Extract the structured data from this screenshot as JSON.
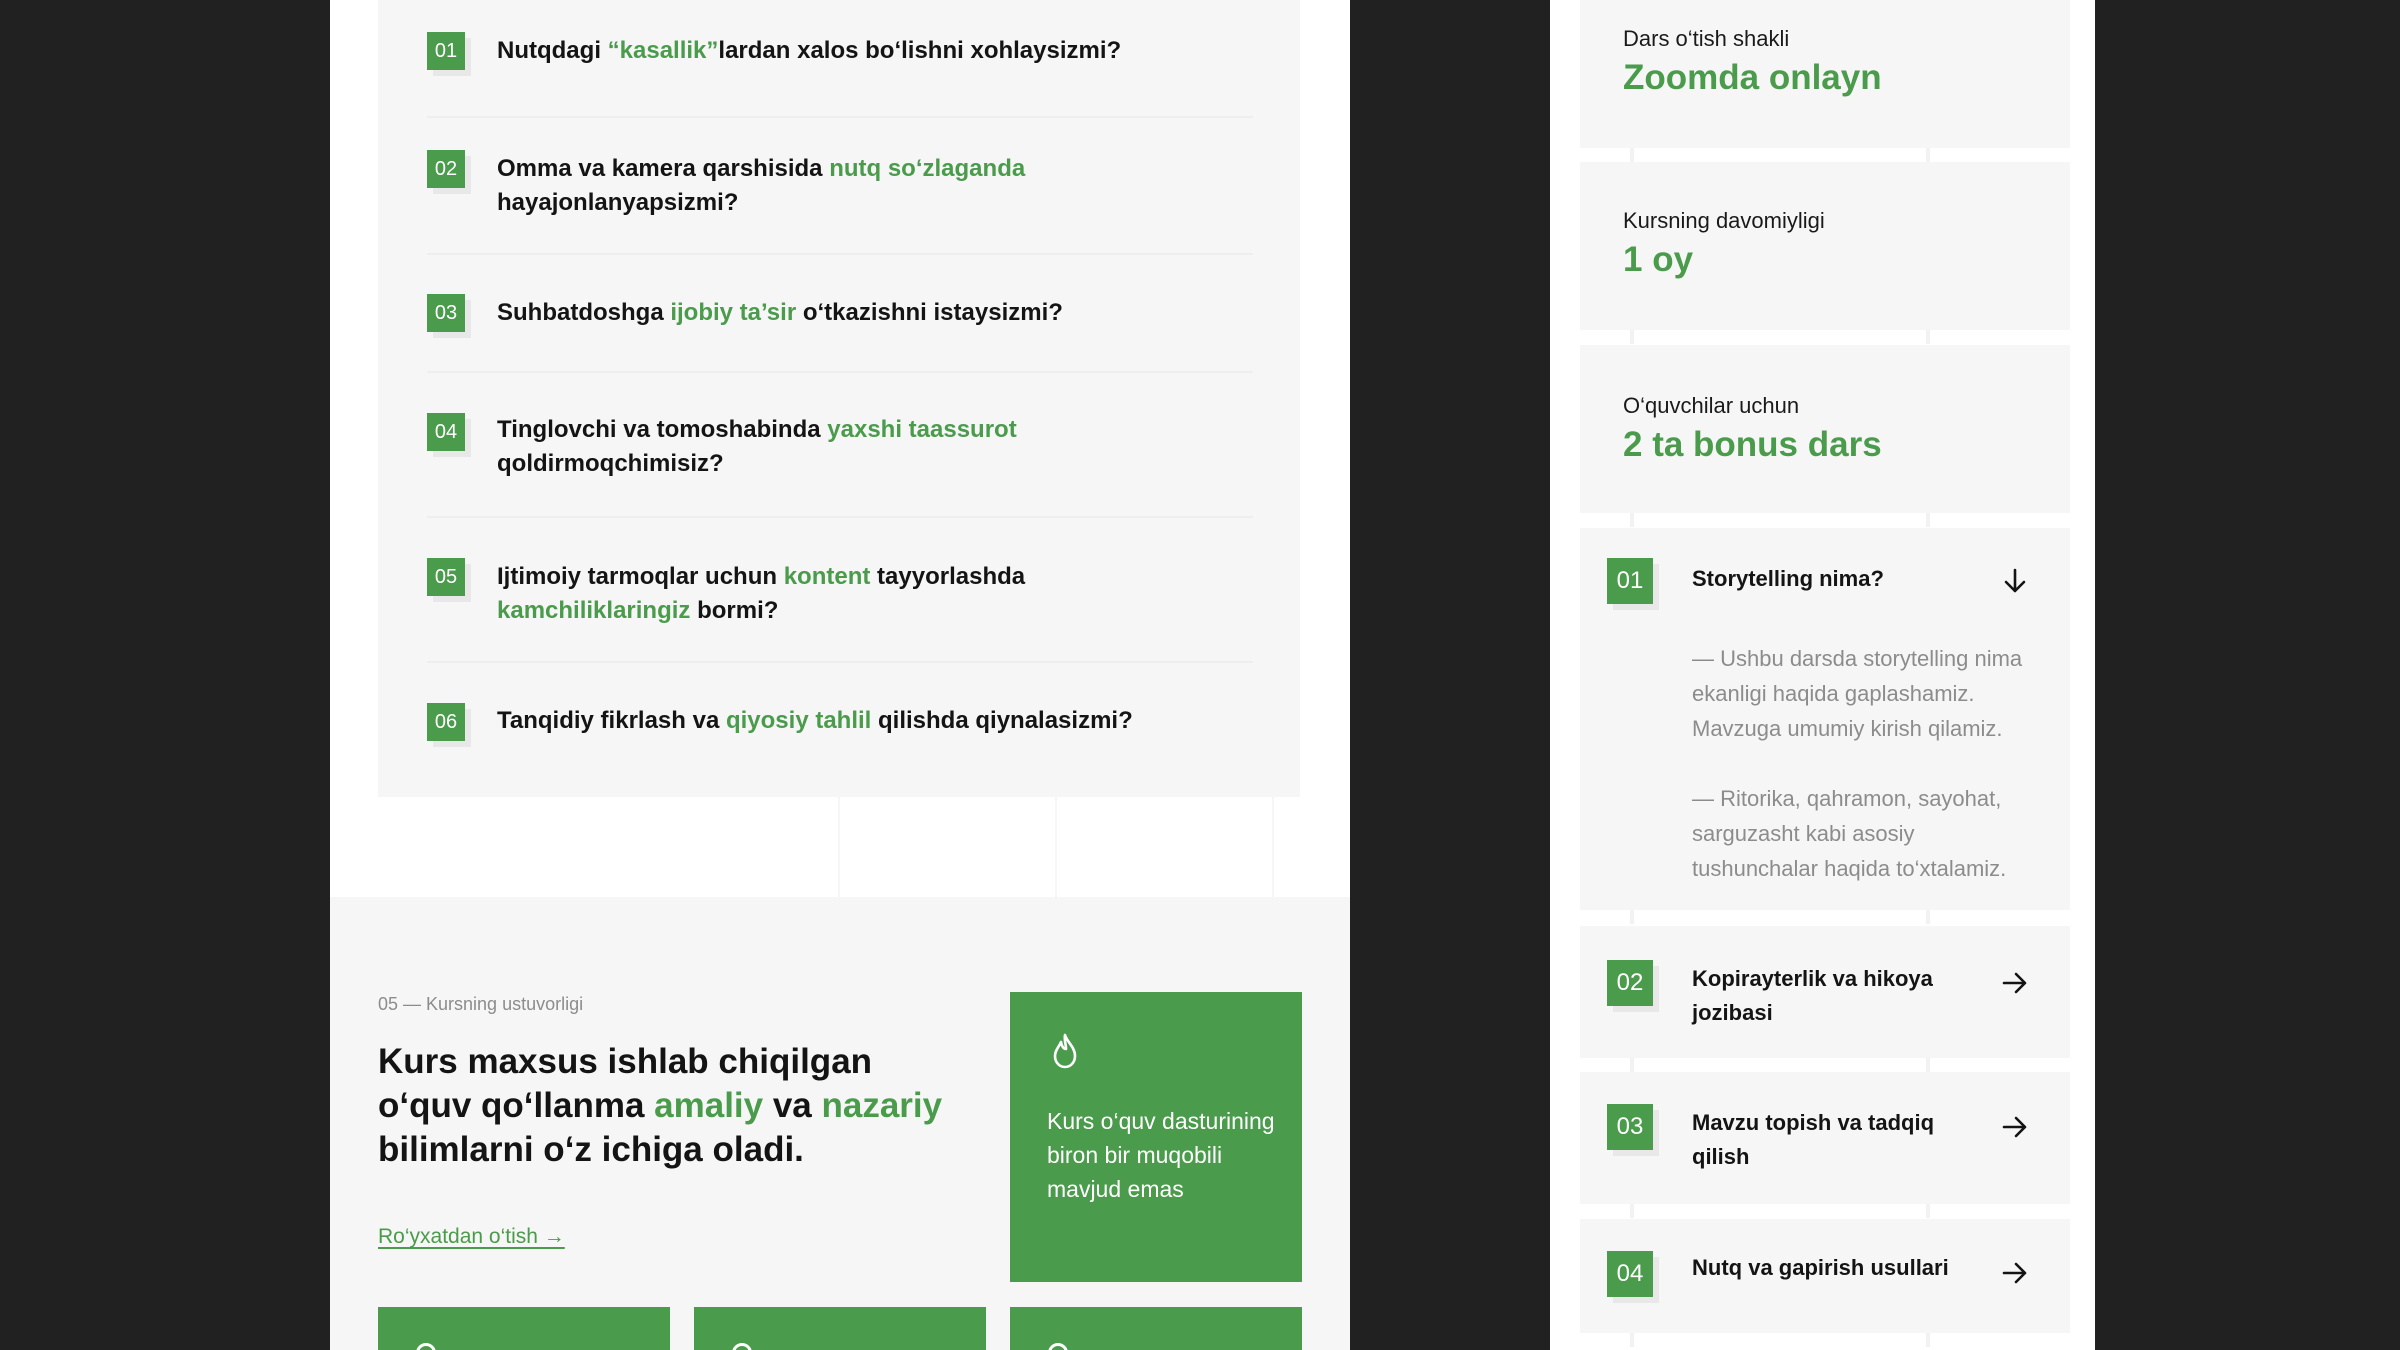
{
  "colors": {
    "accent": "#4a9b4b",
    "page_bg": "#212121",
    "card_bg": "#f6f6f6"
  },
  "questions": [
    {
      "num": "01",
      "parts": [
        "Nutqdagi ",
        "“kasallik”",
        "lardan xalos bo‘lishni xohlaysizmi?"
      ]
    },
    {
      "num": "02",
      "parts": [
        "Omma va kamera qarshisida ",
        "nutq so‘zlaganda",
        "hayajonlanyapsizmi?"
      ]
    },
    {
      "num": "03",
      "parts": [
        "Suhbatdoshga ",
        "ijobiy ta’sir",
        " o‘tkazishni istaysizmi?"
      ]
    },
    {
      "num": "04",
      "parts": [
        "Tinglovchi va tomoshabinda ",
        "yaxshi taassurot",
        "qoldirmoqchimisiz?"
      ]
    },
    {
      "num": "05",
      "parts": [
        "Ijtimoiy tarmoqlar uchun ",
        "kontent",
        " tayyorlashda",
        "kamchiliklaringiz",
        " bormi?"
      ]
    },
    {
      "num": "06",
      "parts": [
        "Tanqidiy fikrlash va ",
        "qiyosiy tahlil",
        " qilishda qiynalasizmi?"
      ]
    }
  ],
  "benefits": {
    "eyebrow": "05 — Kursning ustuvorligi",
    "heading_parts": [
      "Kurs maxsus ishlab chiqilgan o‘quv qo‘llanma ",
      "amaliy",
      " va ",
      "nazariy",
      " bilimlarni o‘z ichiga oladi."
    ],
    "link": "Ro‘yxatdan o‘tish →",
    "card_text": "Kurs o‘quv dasturining biron bir muqobili mavjud emas",
    "card_icon": "flame-icon"
  },
  "info": [
    {
      "label": "Dars o‘tish shakli",
      "value": "Zoomda onlayn"
    },
    {
      "label": "Kursning davomiyligi",
      "value": "1 oy"
    },
    {
      "label": "O‘quvchilar uchun",
      "value": "2 ta bonus dars"
    }
  ],
  "lessons": [
    {
      "num": "01",
      "title": "Storytelling nima?",
      "icon": "arrow-down-icon",
      "body": [
        "— Ushbu darsda storytelling nima ekanligi haqida gaplashamiz. Mavzuga umumiy kirish qilamiz.",
        "— Ritorika, qahramon, sayohat, sarguzasht kabi asosiy tushunchalar haqida to‘xtalamiz."
      ]
    },
    {
      "num": "02",
      "title": "Kopirayterlik va hikoya jozibasi",
      "icon": "arrow-right-icon"
    },
    {
      "num": "03",
      "title": "Mavzu topish va tadqiq qilish",
      "icon": "arrow-right-icon"
    },
    {
      "num": "04",
      "title": "Nutq va gapirish usullari",
      "icon": "arrow-right-icon"
    }
  ]
}
